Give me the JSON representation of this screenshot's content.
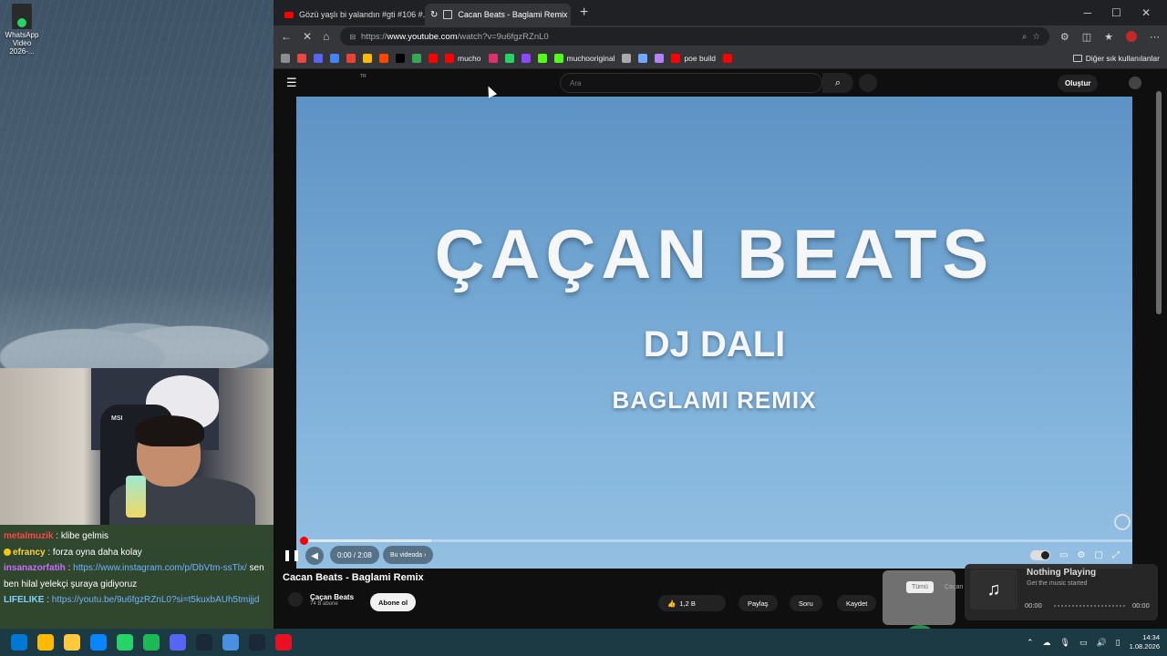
{
  "desktop": {
    "icon_label": "WhatsApp Video 2026-..."
  },
  "stream": {
    "webcam_logo": "MSI",
    "chat": [
      {
        "user": "metalmuzik",
        "user_color": "#ff4545",
        "text": "klibe gelmis",
        "link": ""
      },
      {
        "user": "efrancy",
        "user_color": "#ffd23f",
        "text": "forza oyna daha kolay",
        "link": ""
      },
      {
        "user": "insanazorfatih",
        "user_color": "#c86dff",
        "text": "",
        "link": "https://www.instagram.com/p/DbVtm-ssTlx/",
        "suffix": "sen"
      },
      {
        "user": "",
        "user_color": "#ffffff",
        "text": "ben hilal yelekçi şuraya gidiyoruz",
        "link": ""
      },
      {
        "user": "LIFELIKE",
        "user_color": "#7fd0ff",
        "text": "",
        "link": "https://youtu.be/9u6fgzRZnL0?si=t5kuxbAUh5tmijjd"
      }
    ]
  },
  "browser": {
    "tabs": [
      {
        "title": "Gözü yaşlı bi yalandın #gti #106 #...",
        "active": false
      },
      {
        "title": "Cacan Beats - Baglami Remix",
        "active": true
      }
    ],
    "new_tab": "+",
    "url": {
      "prefix": "https://",
      "host": "www.youtube.com",
      "path": "/watch?v=9u6fgzRZnL0"
    },
    "bookmarks": [
      {
        "label": "",
        "color": "#8e8e8e"
      },
      {
        "label": "",
        "color": "#e44"
      },
      {
        "label": "",
        "color": "#5865f2"
      },
      {
        "label": "",
        "color": "#4285f4"
      },
      {
        "label": "",
        "color": "#ea4335"
      },
      {
        "label": "",
        "color": "#fbbc05"
      },
      {
        "label": "",
        "color": "#ff4500"
      },
      {
        "label": "",
        "color": "#000000"
      },
      {
        "label": "",
        "color": "#34a853"
      },
      {
        "label": "",
        "color": "#ff0000"
      },
      {
        "label": "mucho",
        "color": "#ff0000"
      },
      {
        "label": "",
        "color": "#e1306c"
      },
      {
        "label": "",
        "color": "#25d366"
      },
      {
        "label": "",
        "color": "#9146ff"
      },
      {
        "label": "",
        "color": "#53fc18"
      },
      {
        "label": "muchooriginal",
        "color": "#53fc18"
      },
      {
        "label": "",
        "color": "#aaaaaa"
      },
      {
        "label": "",
        "color": "#6fa8ff"
      },
      {
        "label": "",
        "color": "#b084f5"
      },
      {
        "label": "poe build",
        "color": "#ff0000"
      },
      {
        "label": "",
        "color": "#ff0000"
      }
    ],
    "other_bookmarks": "Diğer sık kullanılanlar"
  },
  "youtube": {
    "logo_sup": "TR",
    "search_placeholder": "Ara",
    "create_label": "Oluştur",
    "video": {
      "title_art": "ÇAÇAN BEATS",
      "artist_art": "DJ DALI",
      "subtitle_art": "BAGLAMI REMIX",
      "time": "0:00 / 2:08",
      "chapter": "Bu videoda",
      "progress": 0
    },
    "info": {
      "title": "Cacan Beats - Baglami Remix",
      "channel": "Çaçan Beats",
      "subscribers": "74 B abone",
      "subscribe_label": "Abone ol",
      "likes": "1,2 B",
      "share_label": "Paylaş",
      "ask_label": "Soru",
      "save_label": "Kaydet"
    },
    "chips": {
      "all": "Tümü",
      "second": "Çaçan"
    }
  },
  "music_widget": {
    "title": "Nothing Playing",
    "subtitle": "Get the music started",
    "time_start": "00:00",
    "time_end": "00:00"
  },
  "taskbar": {
    "icons": [
      "#0078d4",
      "#ffb900",
      "#ffc83d",
      "#0a84ff",
      "#25d366",
      "#1db954",
      "#5865f2",
      "#1b2838",
      "#4a90e2",
      "#1b2838",
      "#e81123"
    ],
    "time": "14:34",
    "date": "1.08.2026"
  }
}
